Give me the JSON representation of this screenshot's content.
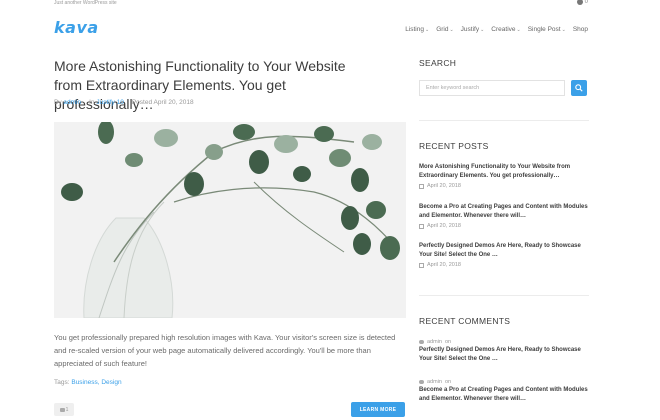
{
  "header": {
    "tagline": "Just another WordPress site",
    "cart_count": "0",
    "logo": "kava",
    "nav": [
      {
        "label": "Listing",
        "has_dropdown": true
      },
      {
        "label": "Grid",
        "has_dropdown": true
      },
      {
        "label": "Justify",
        "has_dropdown": true
      },
      {
        "label": "Creative",
        "has_dropdown": true
      },
      {
        "label": "Single Post",
        "has_dropdown": true
      },
      {
        "label": "Shop",
        "has_dropdown": false
      }
    ]
  },
  "post": {
    "title": "More Astonishing Functionality to Your Website from Extraordinary Elements. You get professionally…",
    "meta": {
      "by_prefix": "By",
      "author": "admin",
      "in_prefix": "In",
      "category": "Justify 10",
      "posted_prefix": "Posted",
      "date": "April 20, 2018"
    },
    "excerpt": "You get professionally prepared high resolution images with Kava. Your visitor's screen size is detected and re-scaled version of your web page automatically delivered accordingly. You'll be more than appreciated of such feature!",
    "tags_prefix": "Tags:",
    "tags": "Business, Design",
    "comment_count": "1",
    "read_more": "LEARN MORE"
  },
  "sidebar": {
    "search": {
      "title": "SEARCH",
      "placeholder": "Enter keyword search"
    },
    "recent_posts": {
      "title": "RECENT POSTS",
      "items": [
        {
          "title": "More Astonishing Functionality to Your Website from Extraordinary Elements. You get professionally…",
          "date": "April 20, 2018"
        },
        {
          "title": "Become a Pro at Creating Pages and Content with Modules and Elementor. Whenever there will…",
          "date": "April 20, 2018"
        },
        {
          "title": "Perfectly Designed Demos Are Here, Ready to Showcase Your Site! Select the One …",
          "date": "April 20, 2018"
        }
      ]
    },
    "recent_comments": {
      "title": "RECENT COMMENTS",
      "items": [
        {
          "author": "admin",
          "on": "on",
          "post": "Perfectly Designed Demos Are Here, Ready to Showcase Your Site! Select the One …"
        },
        {
          "author": "admin",
          "on": "on",
          "post": "Become a Pro at Creating Pages and Content with Modules and Elementor. Whenever there will…"
        }
      ]
    }
  },
  "colors": {
    "accent": "#3ba0e8",
    "text_dark": "#3d3d3d",
    "text_muted": "#999999"
  }
}
